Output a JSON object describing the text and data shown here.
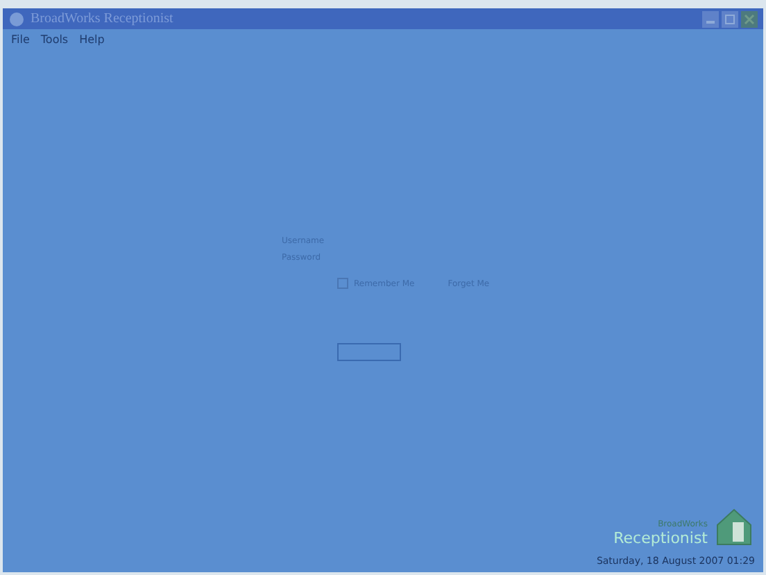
{
  "window": {
    "title": "BroadWorks Receptionist"
  },
  "menu": [
    "File",
    "Tools",
    "Help"
  ],
  "login": {
    "username_label": "Username",
    "password_label": "Password",
    "remember": {
      "label": "Remember Me",
      "checked": false
    },
    "forget_link": "Forget Me"
  },
  "brand": {
    "line_1": "BroadWorks",
    "line_2": "Receptionist"
  },
  "status": "Saturday, 18 August 2007 01:29"
}
